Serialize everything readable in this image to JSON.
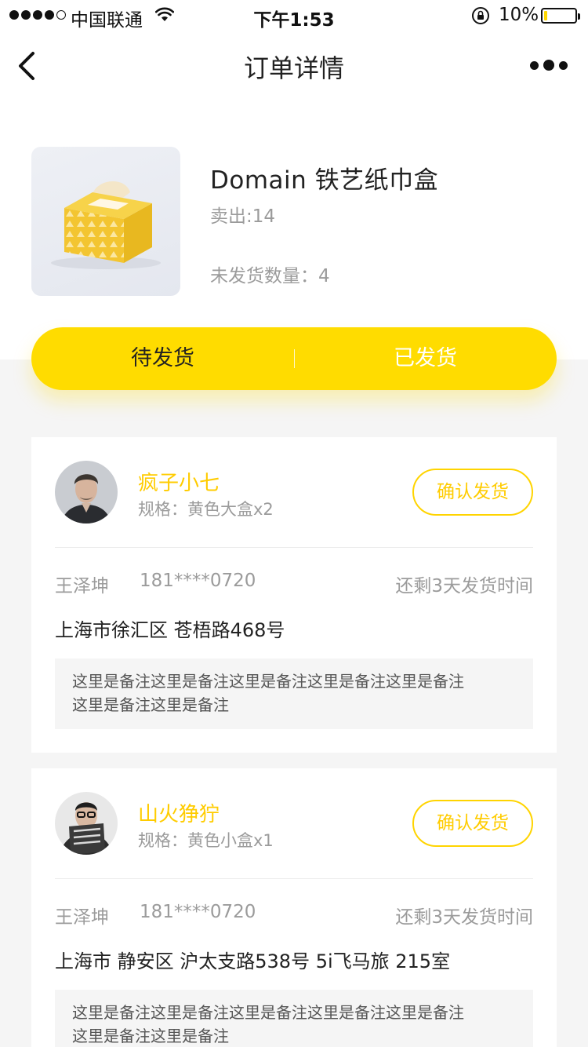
{
  "status_bar": {
    "carrier": "中国联通",
    "time": "下午1:53",
    "battery_percent": "10%",
    "battery_level": 0.1
  },
  "nav": {
    "title": "订单详情"
  },
  "product": {
    "name": "Domain 铁艺纸巾盒",
    "sold": "卖出:14",
    "unshipped": "未发货数量：4"
  },
  "tabs": [
    {
      "label": "待发货"
    },
    {
      "label": "已发货"
    }
  ],
  "orders": [
    {
      "buyer_name": "疯子小七",
      "spec": "规格：黄色大盒x2",
      "confirm_label": "确认发货",
      "recipient": "王泽坤",
      "phone": "181****0720",
      "deadline": "还剩3天发货时间",
      "address": "上海市徐汇区 苍梧路468号",
      "note_line1": "这里是备注这里是备注这里是备注这里是备注这里是备注",
      "note_line2": "这里是备注这里是备注"
    },
    {
      "buyer_name": "山火狰狞",
      "spec": "规格：黄色小盒x1",
      "confirm_label": "确认发货",
      "recipient": "王泽坤",
      "phone": "181****0720",
      "deadline": "还剩3天发货时间",
      "address": "上海市 静安区 沪太支路538号 5i飞马旅 215室",
      "note_line1": "这里是备注这里是备注这里是备注这里是备注这里是备注",
      "note_line2": "这里是备注这里是备注"
    }
  ],
  "icons": {
    "back": "chevron-left-icon",
    "more": "more-dots-icon",
    "wifi": "wifi-icon",
    "rotation_lock": "rotation-lock-icon",
    "battery": "battery-icon"
  },
  "colors": {
    "accent": "#ffdc00",
    "accent_text": "#ffcc00",
    "background": "#f5f5f5"
  }
}
